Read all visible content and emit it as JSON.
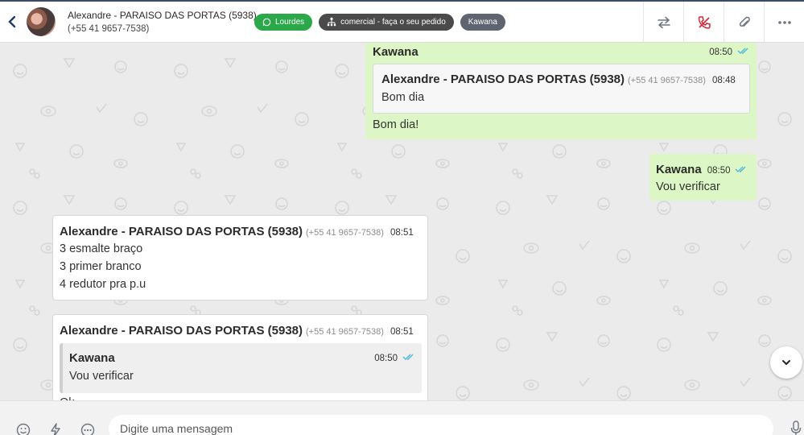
{
  "header": {
    "back_icon": "chevron-left-icon",
    "contact_name": "Alexandre - PARAISO DAS PORTAS (5938)",
    "contact_phone": "(+55 41 9657-7538)",
    "tags": [
      {
        "label": "Lourdes",
        "icon": "whatsapp-icon",
        "color": "#2aa84a"
      },
      {
        "label": "comercial - faça o seu pedido",
        "icon": "sitemap-icon",
        "color": "#4a4a4a"
      },
      {
        "label": "Kawana",
        "icon": "",
        "color": "#5e6470"
      }
    ],
    "actions": [
      "transfer-icon",
      "hangup-icon",
      "attach-icon",
      "more-icon"
    ]
  },
  "messages": [
    {
      "direction": "outgoing",
      "sender": "Kawana",
      "time": "08:50",
      "quoted": {
        "sender": "Alexandre - PARAISO DAS PORTAS (5938)",
        "phone": "(+55 41 9657-7538)",
        "time": "08:48",
        "text": "Bom dia"
      },
      "text": "Bom dia!"
    },
    {
      "direction": "outgoing",
      "sender": "Kawana",
      "time": "08:50",
      "text": "Vou verificar"
    },
    {
      "direction": "incoming",
      "sender": "Alexandre - PARAISO DAS PORTAS (5938)",
      "phone": "(+55 41 9657-7538)",
      "time": "08:51",
      "lines": [
        "3 esmalte braço",
        "3 primer branco",
        "4 redutor pra p.u"
      ]
    },
    {
      "direction": "incoming",
      "sender": "Alexandre - PARAISO DAS PORTAS (5938)",
      "phone": "(+55 41 9657-7538)",
      "time": "08:51",
      "quoted": {
        "sender": "Kawana",
        "time": "08:50",
        "text": "Vou verificar"
      },
      "text": "Ok"
    }
  ],
  "composer": {
    "placeholder": "Digite uma mensagem",
    "icons": [
      "emoji-icon",
      "quick-reply-icon",
      "more-options-icon",
      "microphone-icon"
    ]
  },
  "colors": {
    "outgoing": "#dcf7c5",
    "incoming": "#ffffff",
    "accent_green": "#2aa84a",
    "read_ticks": "#4fb6e0",
    "hangup": "#d0263a"
  }
}
